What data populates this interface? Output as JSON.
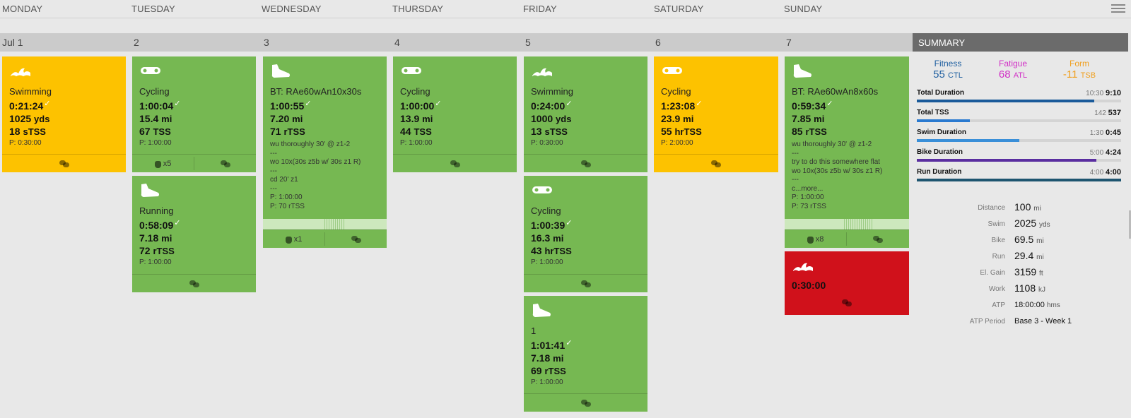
{
  "header": {
    "days": [
      "MONDAY",
      "TUESDAY",
      "WEDNESDAY",
      "THURSDAY",
      "FRIDAY",
      "SATURDAY",
      "SUNDAY"
    ],
    "dates": [
      "Jul 1",
      "2",
      "3",
      "4",
      "5",
      "6",
      "7"
    ],
    "menu_icon": "hamburger-menu-icon"
  },
  "summary": {
    "title": "SUMMARY",
    "fitness": {
      "label": "Fitness",
      "value": "55",
      "unit": "CTL",
      "color": "#1f5fa0"
    },
    "fatigue": {
      "label": "Fatigue",
      "value": "68",
      "unit": "ATL",
      "color": "#d12fc6"
    },
    "form": {
      "label": "Form",
      "value": "-11",
      "unit": "TSB",
      "color": "#f0a020"
    },
    "durations": [
      {
        "label": "Total Duration",
        "planned": "10:30",
        "actual": "9:10",
        "fill": 0.87,
        "color": "#1a5a9a"
      },
      {
        "label": "Total TSS",
        "planned": "142",
        "actual": "537",
        "fill": 0.26,
        "color": "#2a7ad0"
      },
      {
        "label": "Swim Duration",
        "planned": "1:30",
        "actual": "0:45",
        "fill": 0.5,
        "color": "#3a8fd8"
      },
      {
        "label": "Bike Duration",
        "planned": "5:00",
        "actual": "4:24",
        "fill": 0.88,
        "color": "#5a2ea0"
      },
      {
        "label": "Run Duration",
        "planned": "4:00",
        "actual": "4:00",
        "fill": 1.0,
        "color": "#1e5570"
      }
    ],
    "stats": [
      {
        "label": "Distance",
        "value": "100",
        "unit": "mi"
      },
      {
        "label": "Swim",
        "value": "2025",
        "unit": "yds"
      },
      {
        "label": "Bike",
        "value": "69.5",
        "unit": "mi"
      },
      {
        "label": "Run",
        "value": "29.4",
        "unit": "mi"
      },
      {
        "label": "El. Gain",
        "value": "3159",
        "unit": "ft"
      },
      {
        "label": "Work",
        "value": "1108",
        "unit": "kJ"
      },
      {
        "label": "ATP",
        "value": "18:00:00",
        "unit": "hms"
      },
      {
        "label": "ATP Period",
        "value": "Base 3 - Week 1",
        "unit": ""
      }
    ]
  },
  "workouts": {
    "mon_swim": {
      "title": "Swimming",
      "duration": "0:21:24",
      "distance": "1025",
      "distance_unit": "yds",
      "tss": "18",
      "tss_unit": "sTSS",
      "planned": "P: 0:30:00",
      "icon": "swimming-icon"
    },
    "tue_cycling": {
      "title": "Cycling",
      "duration": "1:00:04",
      "distance": "15.4",
      "distance_unit": "mi",
      "tss": "67",
      "tss_unit": "TSS",
      "planned": "P: 1:00:00",
      "icon": "cycling-icon",
      "exercises": "x5"
    },
    "tue_running": {
      "title": "Running",
      "duration": "0:58:09",
      "distance": "7.18",
      "distance_unit": "mi",
      "tss": "72",
      "tss_unit": "rTSS",
      "planned": "P: 1:00:00",
      "icon": "running-icon"
    },
    "wed_bt": {
      "title": "BT: RAe60wAn10x30s",
      "duration": "1:00:55",
      "distance": "7.20",
      "distance_unit": "mi",
      "tss": "71",
      "tss_unit": "rTSS",
      "icon": "running-icon",
      "exercises": "x1",
      "desc": [
        "wu thoroughly 30' @ z1-2",
        "---",
        "wo 10x(30s z5b w/ 30s z1 R)",
        "---",
        "cd 20' z1",
        "---",
        "P: 1:00:00",
        "P: 70 rTSS"
      ]
    },
    "thu_cycling": {
      "title": "Cycling",
      "duration": "1:00:00",
      "distance": "13.9",
      "distance_unit": "mi",
      "tss": "44",
      "tss_unit": "TSS",
      "planned": "P: 1:00:00",
      "icon": "cycling-icon"
    },
    "fri_swim": {
      "title": "Swimming",
      "duration": "0:24:00",
      "distance": "1000",
      "distance_unit": "yds",
      "tss": "13",
      "tss_unit": "sTSS",
      "planned": "P: 0:30:00",
      "icon": "swimming-icon"
    },
    "fri_cycling": {
      "title": "Cycling",
      "duration": "1:00:39",
      "distance": "16.3",
      "distance_unit": "mi",
      "tss": "43",
      "tss_unit": "hrTSS",
      "planned": "P: 1:00:00",
      "icon": "cycling-icon"
    },
    "fri_run": {
      "title": "1",
      "duration": "1:01:41",
      "distance": "7.18",
      "distance_unit": "mi",
      "tss": "69",
      "tss_unit": "rTSS",
      "planned": "P: 1:00:00",
      "icon": "running-icon"
    },
    "sat_cycling": {
      "title": "Cycling",
      "duration": "1:23:08",
      "distance": "23.9",
      "distance_unit": "mi",
      "tss": "55",
      "tss_unit": "hrTSS",
      "planned": "P: 2:00:00",
      "icon": "cycling-icon"
    },
    "sun_bt": {
      "title": "BT: RAe60wAn8x60s",
      "duration": "0:59:34",
      "distance": "7.85",
      "distance_unit": "mi",
      "tss": "85",
      "tss_unit": "rTSS",
      "icon": "running-icon",
      "exercises": "x8",
      "desc": [
        "wu thoroughly 30' @ z1-2",
        "---",
        "try to do this somewhere flat",
        "wo 10x(30s z5b w/ 30s z1 R)",
        "---",
        "c...more...",
        "P: 1:00:00",
        "P: 73 rTSS"
      ]
    },
    "sun_swim": {
      "duration": "0:30:00",
      "icon": "swimming-icon"
    }
  },
  "colors": {
    "completed": "#76b852",
    "partial": "#fdc200",
    "missed": "#d0111b"
  }
}
